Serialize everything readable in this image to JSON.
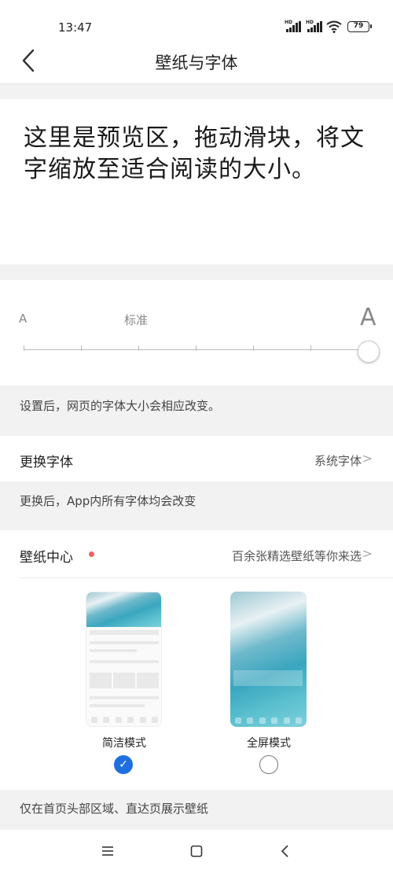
{
  "status": {
    "time": "13:47",
    "battery": "79",
    "hd": "HD"
  },
  "header": {
    "title": "壁纸与字体",
    "back_icon": "chevron-left-icon"
  },
  "preview": {
    "text": "这里是预览区，拖动滑块，将文字缩放至适合阅读的大小。"
  },
  "font_size": {
    "small_label": "A",
    "standard_label": "标准",
    "large_label": "A",
    "selected_step": 6,
    "total_steps": 7
  },
  "notes": {
    "font_size_note": "设置后，网页的字体大小会相应改变。",
    "font_change_note": "更换后，App内所有字体均会改变",
    "wallpaper_note": "仅在首页头部区域、直达页展示壁纸"
  },
  "change_font": {
    "title": "更换字体",
    "value": "系统字体"
  },
  "wallpaper": {
    "title": "壁纸中心",
    "value": "百余张精选壁纸等你来选",
    "modes": [
      {
        "label": "简洁模式",
        "selected": true
      },
      {
        "label": "全屏模式",
        "selected": false
      }
    ]
  },
  "nav": {
    "menu_icon": "menu-icon",
    "home_icon": "home-square-icon",
    "back_icon": "back-triangle-icon"
  },
  "colors": {
    "accent": "#1f6fe0",
    "dot": "#f06464"
  }
}
